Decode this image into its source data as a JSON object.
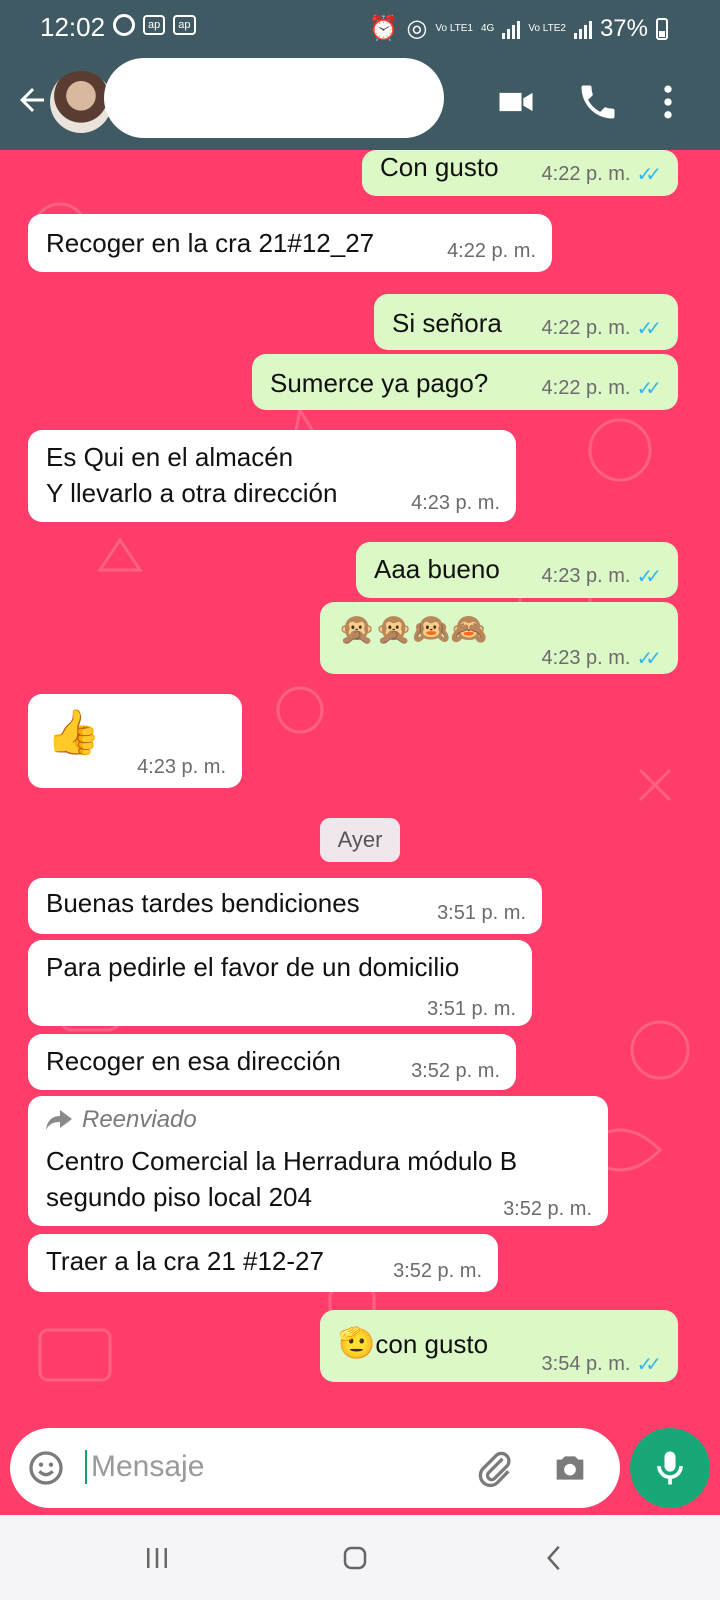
{
  "status_bar": {
    "time": "12:02",
    "left_badges": [
      "ap",
      "ap"
    ],
    "sim1": "Vo LTE1",
    "net": "4G",
    "sim2": "Vo LTE2",
    "battery": "37%"
  },
  "header": {
    "contact_name": "",
    "icons": [
      "back-arrow-icon",
      "video-call-icon",
      "phone-icon",
      "more-vert-icon"
    ]
  },
  "messages": [
    {
      "dir": "out",
      "text": "Con gusto",
      "time": "4:22 p. m.",
      "read": true
    },
    {
      "dir": "in",
      "text": "Recoger en la cra 21#12_27",
      "time": "4:22 p. m."
    },
    {
      "dir": "out",
      "text": "Si señora",
      "time": "4:22 p. m.",
      "read": true
    },
    {
      "dir": "out",
      "text": "Sumerce ya pago?",
      "time": "4:22 p. m.",
      "read": true
    },
    {
      "dir": "in",
      "text_line1": "Es Qui en el almacén",
      "text_line2": "Y llevarlo a otra dirección",
      "time": "4:23 p. m."
    },
    {
      "dir": "out",
      "text": "Aaa bueno",
      "time": "4:23 p. m.",
      "read": true
    },
    {
      "dir": "out",
      "text": "🙊🙊🙉🙈",
      "time": "4:23 p. m.",
      "read": true
    },
    {
      "dir": "in",
      "text": "👍",
      "time": "4:23 p. m."
    },
    {
      "dir": "in",
      "text": "Buenas tardes bendiciones",
      "time": "3:51 p. m."
    },
    {
      "dir": "in",
      "text": "Para pedirle el favor de un domicilio",
      "time": "3:51 p. m."
    },
    {
      "dir": "in",
      "text": "Recoger en esa dirección",
      "time": "3:52 p. m."
    },
    {
      "dir": "in",
      "forwarded_label": "Reenviado",
      "text_line1": "Centro Comercial la Herradura módulo B",
      "text_line2": "segundo piso local 204",
      "time": "3:52 p. m."
    },
    {
      "dir": "in",
      "text": "Traer a la cra 21 #12-27",
      "time": "3:52 p. m."
    },
    {
      "dir": "out",
      "emoji": "🫡",
      "text": "con gusto",
      "time": "3:54 p. m.",
      "read": true
    }
  ],
  "date_divider": "Ayer",
  "input": {
    "placeholder": "Mensaje",
    "icons": [
      "emoji-icon",
      "attach-icon",
      "camera-icon",
      "mic-icon"
    ]
  },
  "colors": {
    "header": "#3f5a63",
    "wallpaper": "#ff3d6a",
    "bubble_out": "#dcf8c6",
    "bubble_in": "#ffffff",
    "read_tick": "#34b7f1",
    "mic_button": "#18a877"
  }
}
